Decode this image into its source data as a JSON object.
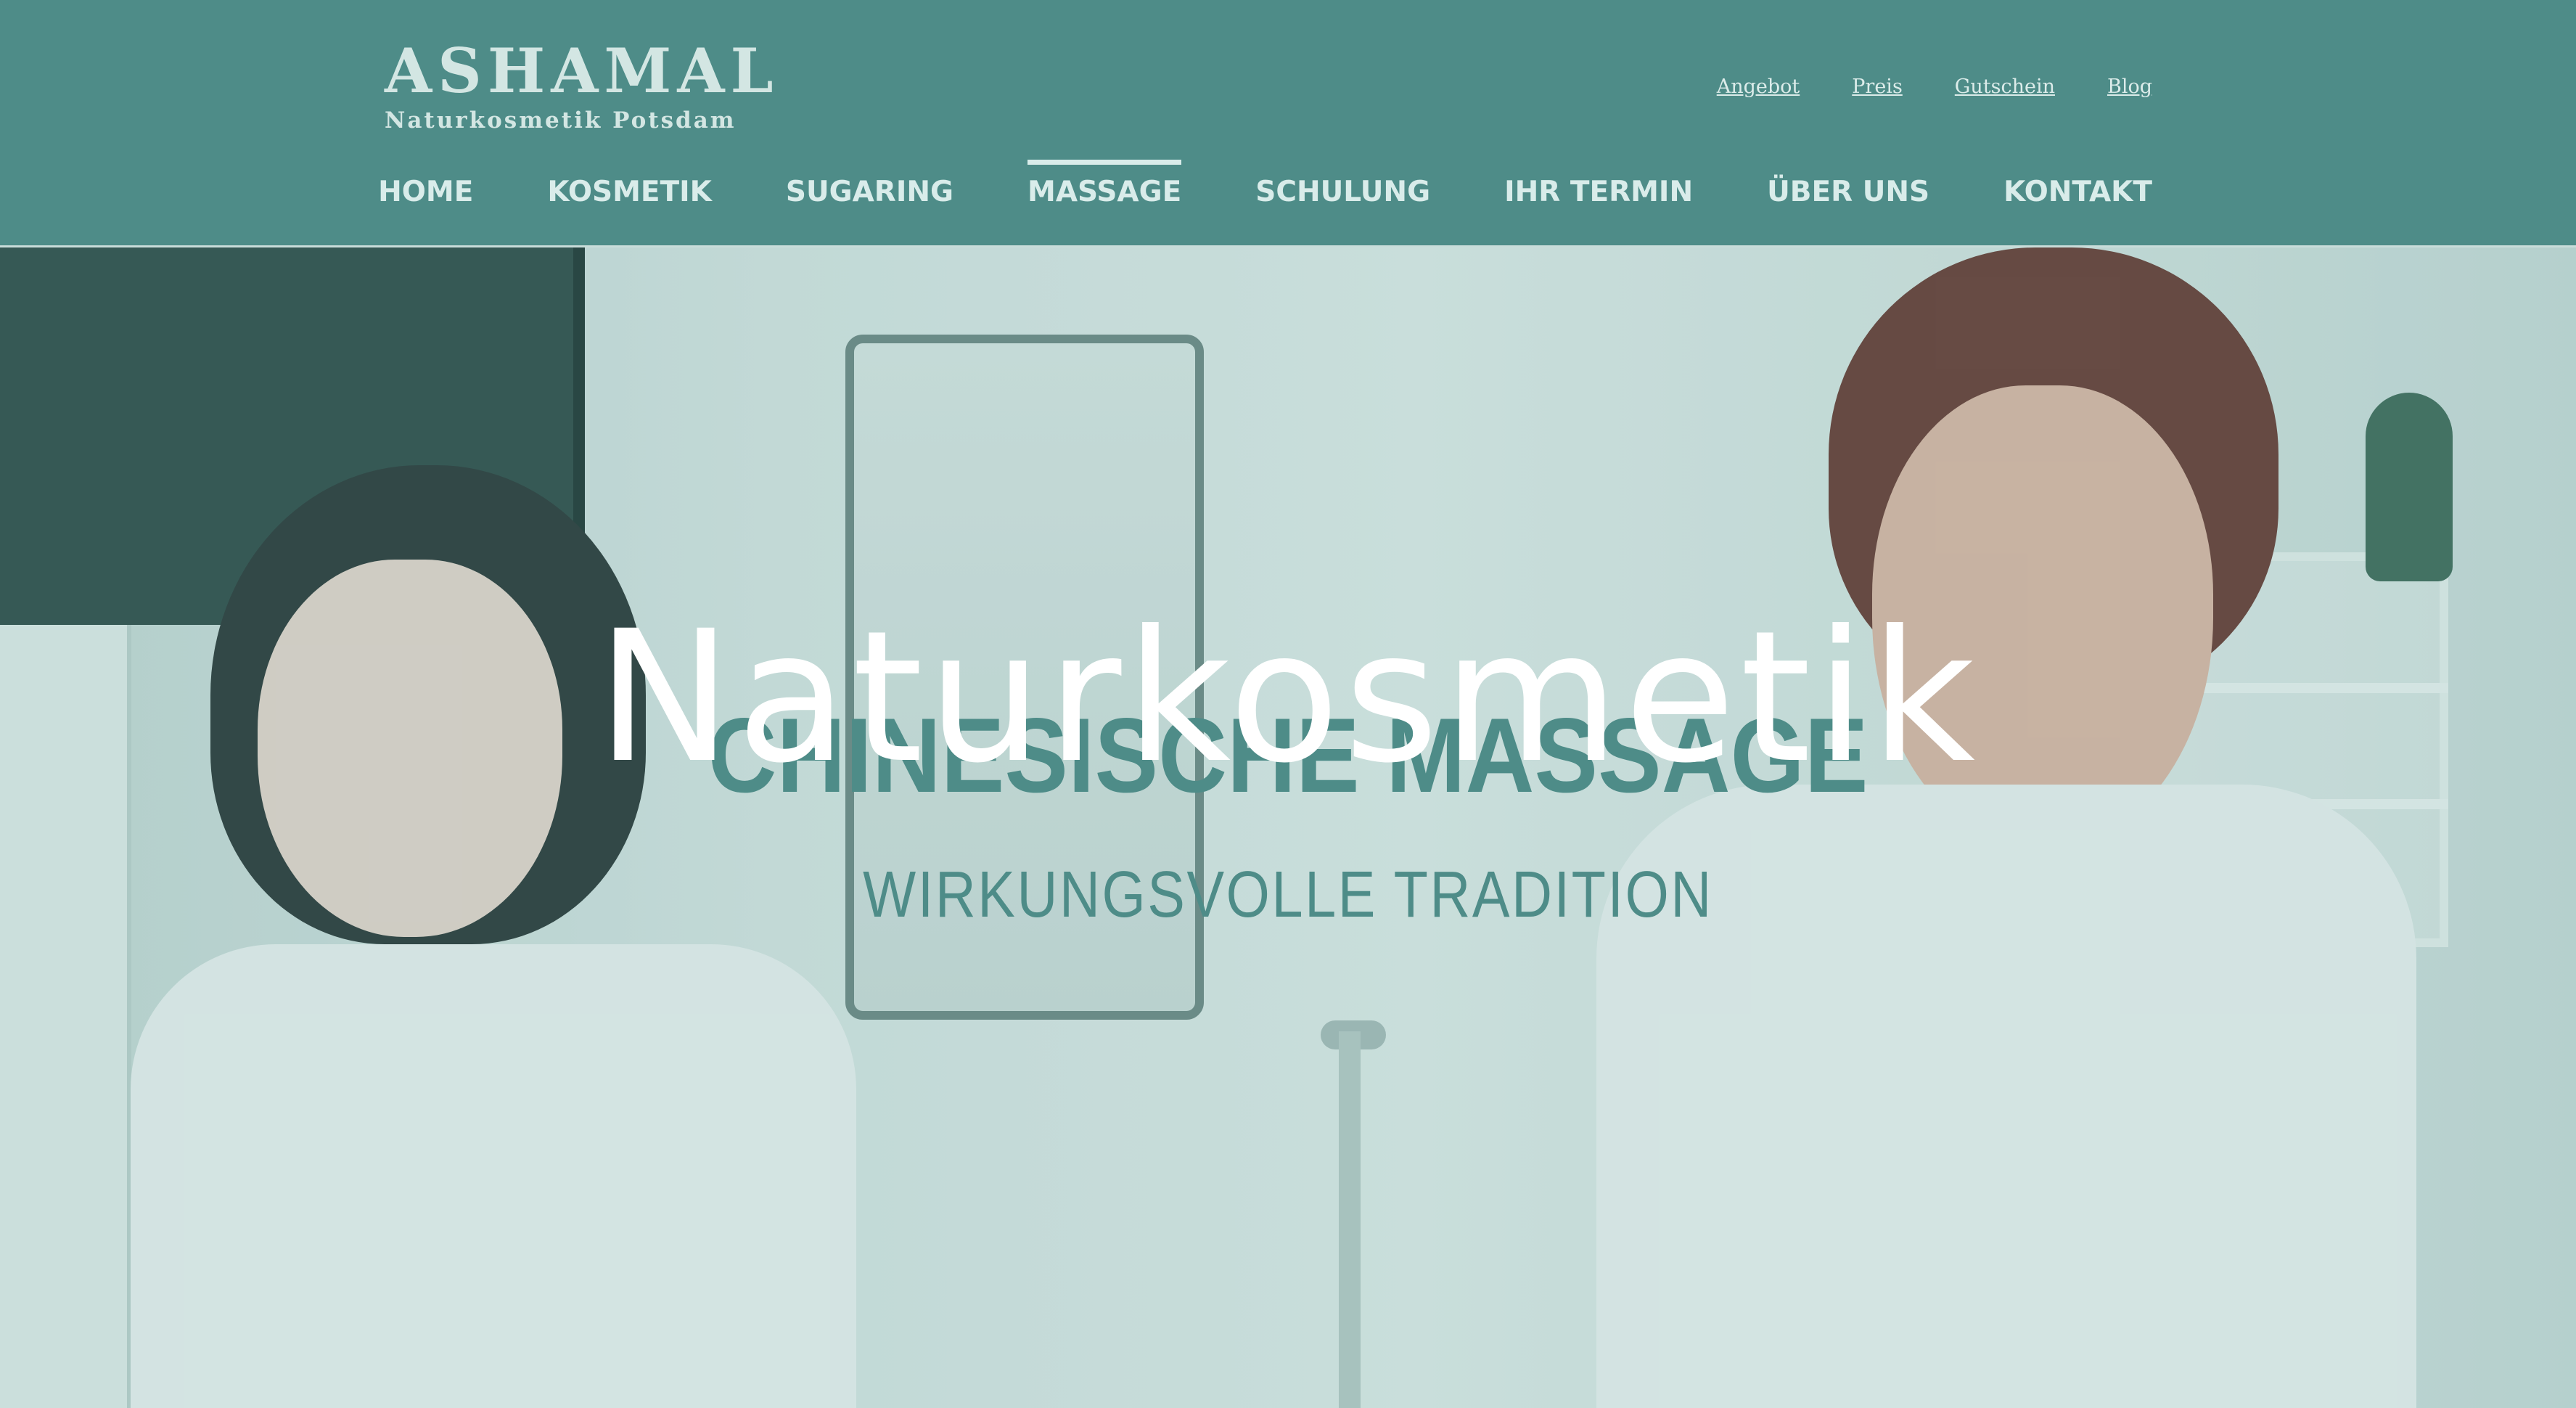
{
  "brand": {
    "name": "ASHAMAL",
    "tagline": "Naturkosmetik Potsdam"
  },
  "top_links": [
    {
      "label": "Angebot"
    },
    {
      "label": "Preis"
    },
    {
      "label": "Gutschein"
    },
    {
      "label": "Blog"
    }
  ],
  "main_nav": [
    {
      "label": "HOME",
      "active": false
    },
    {
      "label": "KOSMETIK",
      "active": false
    },
    {
      "label": "SUGARING",
      "active": false
    },
    {
      "label": "MASSAGE",
      "active": true
    },
    {
      "label": "SCHULUNG",
      "active": false
    },
    {
      "label": "IHR TERMIN",
      "active": false
    },
    {
      "label": "ÜBER UNS",
      "active": false
    },
    {
      "label": "KONTAKT",
      "active": false
    }
  ],
  "hero": {
    "title": "Naturkosmetik",
    "heading": "CHINESISCHE MASSAGE",
    "subheading": "WIRKUNGSVOLLE TRADITION"
  },
  "colors": {
    "header_bg": "#4e8c88",
    "nav_text": "#d9ecea",
    "accent_teal": "#4e8c88",
    "hero_title": "#ffffff"
  }
}
